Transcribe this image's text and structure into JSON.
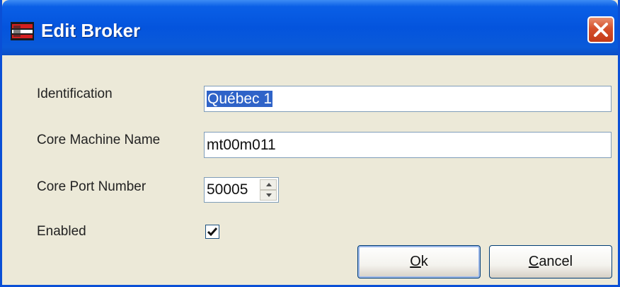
{
  "window": {
    "title": "Edit Broker",
    "icon": "app-icon",
    "close_icon": "close-icon"
  },
  "form": {
    "identification_label": "Identification",
    "identification_value": "Québec 1",
    "core_machine_label": "Core Machine Name",
    "core_machine_value": "mt00m011",
    "core_port_label": "Core Port Number",
    "core_port_value": "50005",
    "enabled_label": "Enabled",
    "enabled_checked": true
  },
  "buttons": {
    "ok_accel": "O",
    "ok_rest": "k",
    "cancel_accel": "C",
    "cancel_rest": "ancel"
  },
  "colors": {
    "titlebar": "#0454dd",
    "close_button": "#d5502b",
    "dialog_background": "#ece9d8",
    "selection": "#2f63c8"
  }
}
